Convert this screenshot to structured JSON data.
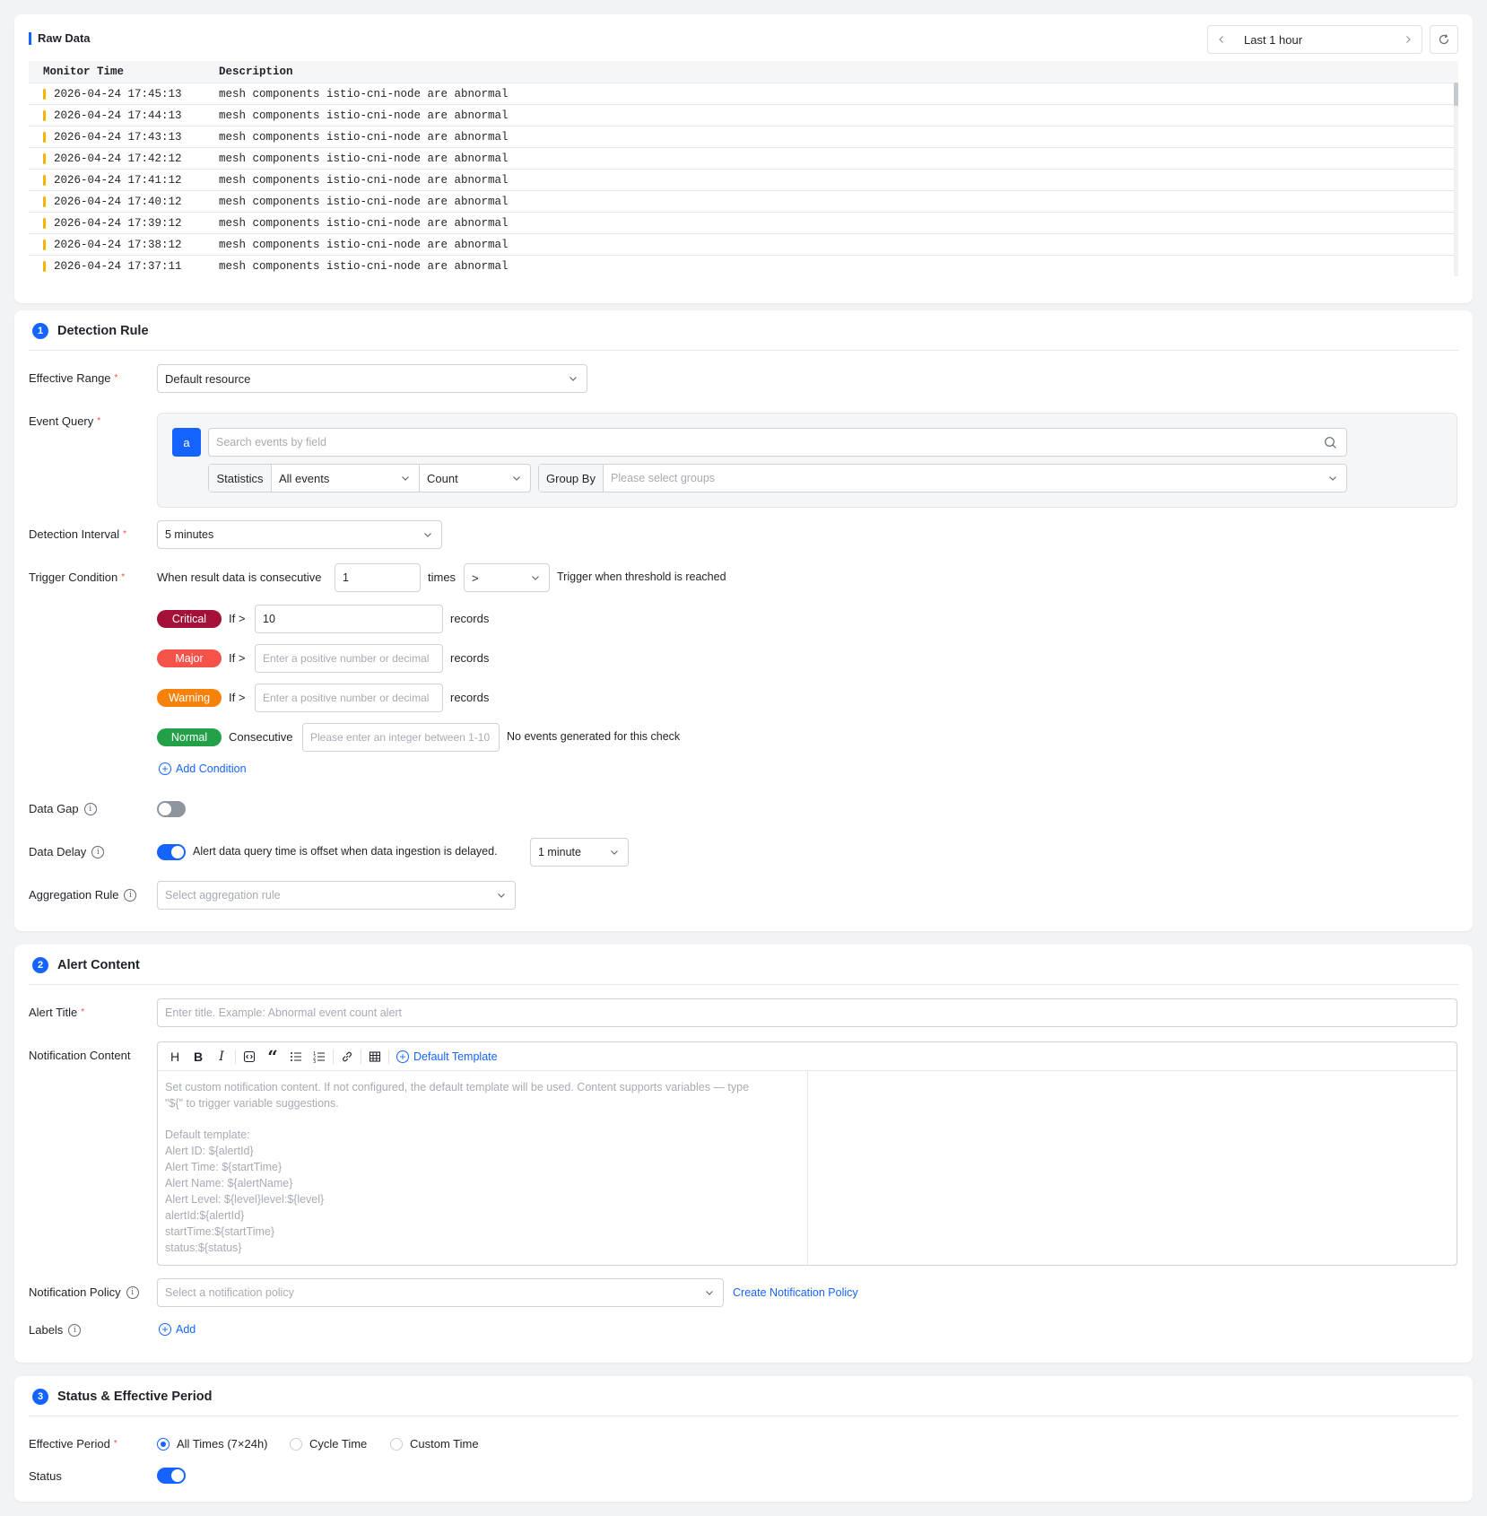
{
  "raw_data": {
    "title": "Raw Data",
    "time_range": "Last 1 hour",
    "columns": [
      "Monitor Time",
      "Description"
    ],
    "rows": [
      {
        "time": "2026-04-24 17:45:13",
        "desc": "mesh components istio-cni-node are abnormal"
      },
      {
        "time": "2026-04-24 17:44:13",
        "desc": "mesh components istio-cni-node are abnormal"
      },
      {
        "time": "2026-04-24 17:43:13",
        "desc": "mesh components istio-cni-node are abnormal"
      },
      {
        "time": "2026-04-24 17:42:12",
        "desc": "mesh components istio-cni-node are abnormal"
      },
      {
        "time": "2026-04-24 17:41:12",
        "desc": "mesh components istio-cni-node are abnormal"
      },
      {
        "time": "2026-04-24 17:40:12",
        "desc": "mesh components istio-cni-node are abnormal"
      },
      {
        "time": "2026-04-24 17:39:12",
        "desc": "mesh components istio-cni-node are abnormal"
      },
      {
        "time": "2026-04-24 17:38:12",
        "desc": "mesh components istio-cni-node are abnormal"
      },
      {
        "time": "2026-04-24 17:37:11",
        "desc": "mesh components istio-cni-node are abnormal"
      }
    ]
  },
  "detection": {
    "num": "1",
    "title": "Detection Rule",
    "effective_range_label": "Effective Range",
    "effective_range_value": "Default resource",
    "event_query_label": "Event Query",
    "query_tag": "a",
    "search_placeholder": "Search events by field",
    "statistics_label": "Statistics",
    "statistics_value": "All events",
    "agg_value": "Count",
    "group_by_label": "Group By",
    "group_by_placeholder": "Please select groups",
    "interval_label": "Detection Interval",
    "interval_value": "5 minutes",
    "trigger_label": "Trigger Condition",
    "trigger_prefix": "When result data is consecutive",
    "trigger_count": "1",
    "trigger_times": "times",
    "trigger_op": ">",
    "trigger_suffix": "Trigger when threshold is reached",
    "levels": [
      {
        "name": "Critical",
        "color": "#a5103a",
        "if": "If >",
        "value": "10",
        "placeholder": "Enter a positive number or decimal",
        "unit": "records"
      },
      {
        "name": "Major",
        "color": "#f5534a",
        "if": "If >",
        "value": "",
        "placeholder": "Enter a positive number or decimal",
        "unit": "records"
      },
      {
        "name": "Warning",
        "color": "#f6820c",
        "if": "If >",
        "value": "",
        "placeholder": "Enter a positive number or decimal",
        "unit": "records"
      }
    ],
    "normal": {
      "name": "Normal",
      "color": "#24a148",
      "label": "Consecutive",
      "placeholder": "Please enter an integer between 1-10",
      "suffix": "No events generated for this check"
    },
    "add_condition": "Add Condition",
    "data_gap_label": "Data Gap",
    "data_gap_on": false,
    "data_delay_label": "Data Delay",
    "data_delay_on": true,
    "data_delay_text": "Alert data query time is offset when data ingestion is delayed.",
    "data_delay_value": "1 minute",
    "aggregation_label": "Aggregation Rule",
    "aggregation_placeholder": "Select aggregation rule"
  },
  "alert": {
    "num": "2",
    "title": "Alert Content",
    "alert_title_label": "Alert Title",
    "alert_title_placeholder": "Enter title. Example: Abnormal event count alert",
    "notification_label": "Notification Content",
    "default_template": "Default Template",
    "editor_placeholder": [
      "Set custom notification content. If not configured, the default template will be used. Content supports variables — type",
      "\"${\" to trigger variable suggestions.",
      "",
      "Default template:",
      "Alert ID: ${alertId}",
      "Alert Time: ${startTime}",
      "Alert Name: ${alertName}",
      "Alert Level: ${level}level:${level}",
      "alertId:${alertId}",
      "startTime:${startTime}",
      "status:${status}"
    ],
    "policy_label": "Notification Policy",
    "policy_placeholder": "Select a notification policy",
    "create_policy": "Create Notification Policy",
    "labels_label": "Labels",
    "labels_add": "Add"
  },
  "status": {
    "num": "3",
    "title": "Status & Effective Period",
    "period_label": "Effective Period",
    "options": [
      "All Times (7×24h)",
      "Cycle Time",
      "Custom Time"
    ],
    "selected": "All Times (7×24h)",
    "status_label": "Status",
    "status_on": true
  },
  "colors": {
    "accent": "#1664ff",
    "bar": "#f5b400"
  }
}
